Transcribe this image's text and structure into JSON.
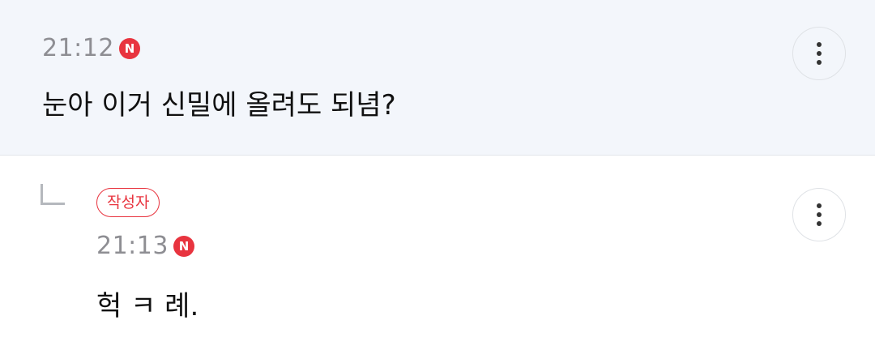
{
  "comments": [
    {
      "time": "21:12",
      "new_badge": "N",
      "text": "눈아 이거 신밀에 올려도 되념?"
    },
    {
      "author_badge": "작성자",
      "time": "21:13",
      "new_badge": "N",
      "text": "헉 ㅋ 례."
    }
  ],
  "icons": {
    "more": "more-vertical-icon",
    "reply": "reply-arrow-icon"
  },
  "colors": {
    "parent_background": "#f3f6fb",
    "accent_red": "#e8343f",
    "time_gray": "#8e8e93",
    "text": "#111111"
  }
}
